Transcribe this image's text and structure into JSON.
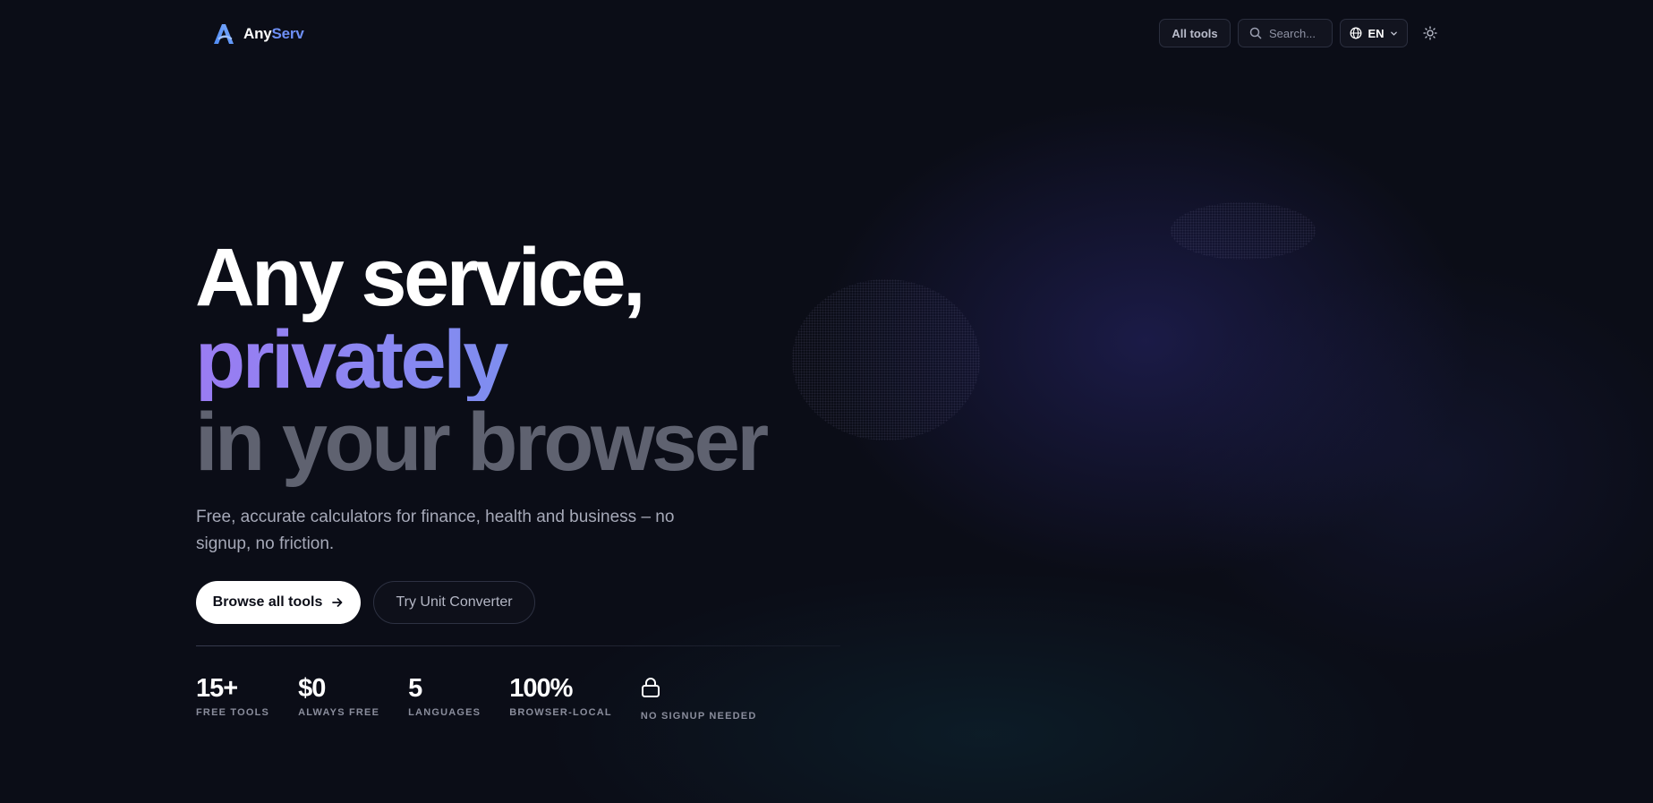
{
  "brand": {
    "name_part1": "Any",
    "name_part2": "Serv",
    "accent_color": "#6e8ff5"
  },
  "nav": {
    "all_tools_label": "All tools",
    "search_placeholder": "Search...",
    "language_label": "EN",
    "icons": [
      "search-icon",
      "globe-icon",
      "chevron-down-icon",
      "sun-icon"
    ]
  },
  "hero": {
    "line1": "Any service,",
    "line2": "privately",
    "line3": "in your browser",
    "subtitle": "Free, accurate calculators for finance, health and business – no signup, no friction."
  },
  "cta": {
    "primary_label": "Browse all tools",
    "secondary_label": "Try Unit Converter"
  },
  "stats": [
    {
      "value": "15+",
      "label": "FREE TOOLS"
    },
    {
      "value": "$0",
      "label": "ALWAYS FREE"
    },
    {
      "value": "5",
      "label": "LANGUAGES"
    },
    {
      "value": "100%",
      "label": "BROWSER-LOCAL"
    },
    {
      "value": "",
      "icon": "lock-icon",
      "label": "NO SIGNUP NEEDED"
    }
  ]
}
